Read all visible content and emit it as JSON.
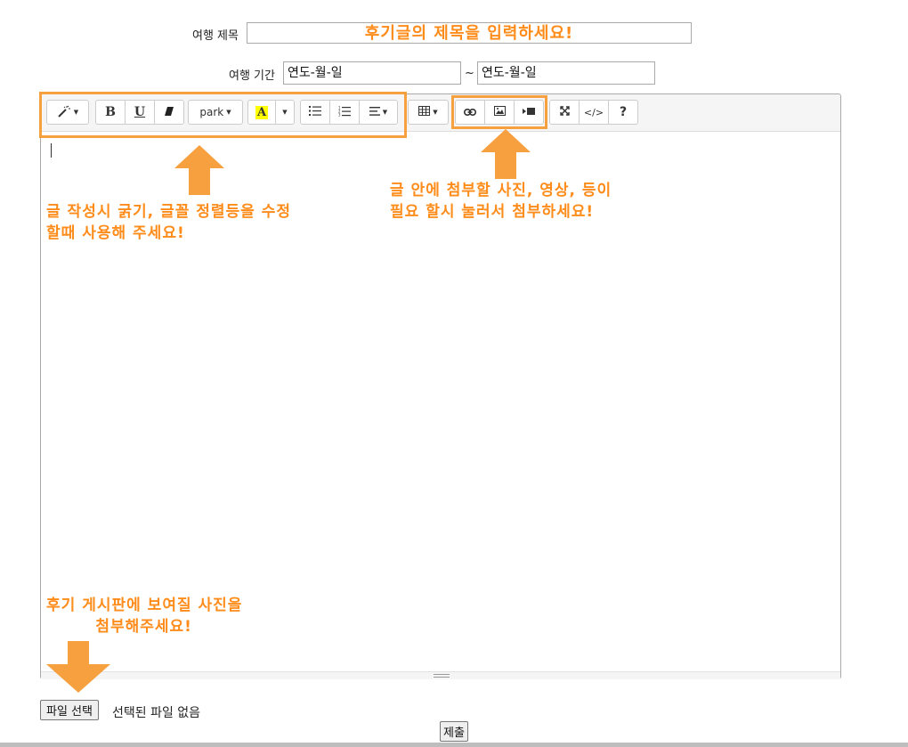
{
  "form": {
    "title_label": "여행 제목",
    "title_placeholder": "후기글의 제목을 입력하세요!",
    "period_label": "여행 기간",
    "start_date_placeholder": "연도-월-일",
    "period_separator": "~",
    "end_date_placeholder": "연도-월-일"
  },
  "toolbar": {
    "style_icon": "magic-wand-icon",
    "bold_label": "B",
    "underline_label": "U",
    "clear_icon": "eraser-icon",
    "font_name": "park",
    "color_label": "A",
    "unordered_list_icon": "bullet-list-icon",
    "ordered_list_icon": "numbered-list-icon",
    "align_icon": "align-icon",
    "table_icon": "table-icon",
    "link_icon": "link-icon",
    "picture_icon": "picture-icon",
    "video_icon": "video-icon",
    "fullscreen_icon": "fullscreen-icon",
    "codeview_label": "</>",
    "help_label": "?"
  },
  "annotations": {
    "toolbar_note": "글 작성시 굵기, 글꼴 정렬등을 수정\n할때 사용해 주세요!",
    "media_note": "글 안에 첨부할 사진, 영상, 등이\n필요 할시 눌러서 첨부하세요!",
    "thumbnail_note": "후기 게시판에 보여질 사진을\n        첨부해주세요!",
    "accent_color": "#ff8c1a",
    "arrow_color": "#f7a040"
  },
  "file": {
    "button_label": "파일 선택",
    "status": "선택된 파일 없음"
  },
  "submit_label": "제출"
}
